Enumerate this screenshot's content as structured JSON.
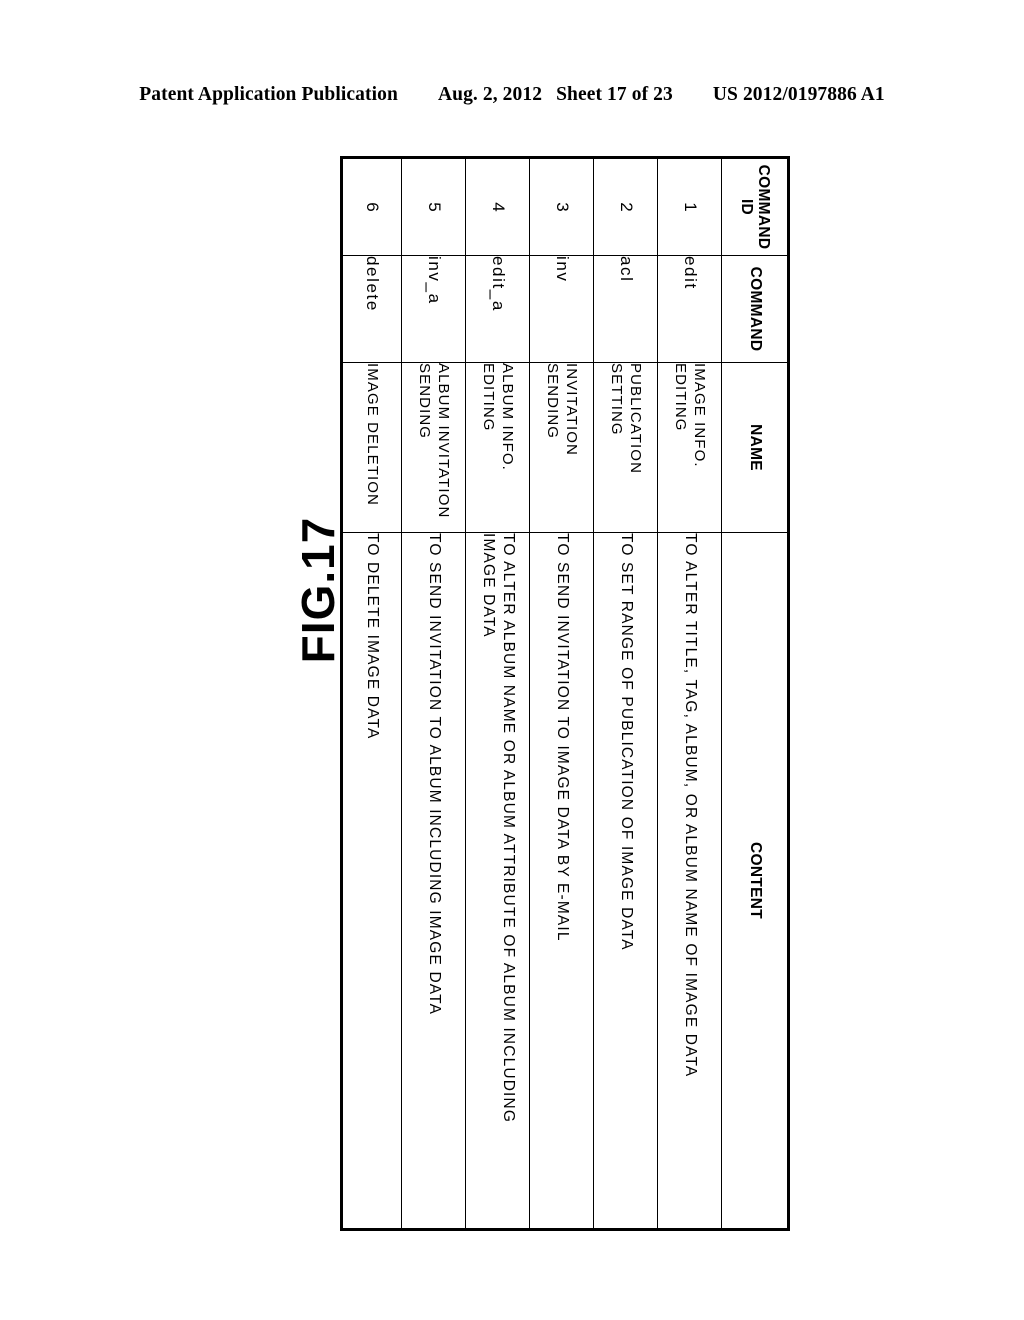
{
  "header": {
    "publication": "Patent Application Publication",
    "date": "Aug. 2, 2012",
    "sheet": "Sheet 17 of 23",
    "pub_number": "US 2012/0197886 A1"
  },
  "figure": {
    "label": "FIG.17"
  },
  "table": {
    "columns": [
      {
        "key": "command_id",
        "label": "COMMAND\nID"
      },
      {
        "key": "command",
        "label": "COMMAND"
      },
      {
        "key": "name",
        "label": "NAME"
      },
      {
        "key": "content",
        "label": "CONTENT"
      }
    ],
    "rows": [
      {
        "command_id": "1",
        "command": "edit",
        "name": "IMAGE INFO.\nEDITING",
        "content": "TO ALTER TITLE, TAG, ALBUM, OR ALBUM NAME OF IMAGE DATA"
      },
      {
        "command_id": "2",
        "command": "acl",
        "name": "PUBLICATION\nSETTING",
        "content": "TO SET RANGE OF PUBLICATION OF IMAGE DATA"
      },
      {
        "command_id": "3",
        "command": "inv",
        "name": "INVITATION\nSENDING",
        "content": "TO SEND INVITATION TO IMAGE DATA BY E-MAIL"
      },
      {
        "command_id": "4",
        "command": "edit_a",
        "name": "ALBUM INFO.\nEDITING",
        "content": "TO ALTER ALBUM NAME OR ALBUM ATTRIBUTE OF ALBUM INCLUDING\nIMAGE DATA"
      },
      {
        "command_id": "5",
        "command": "inv_a",
        "name": "ALBUM INVITATION\nSENDING",
        "content": "TO SEND INVITATION TO ALBUM INCLUDING IMAGE DATA"
      },
      {
        "command_id": "6",
        "command": "delete",
        "name": "IMAGE DELETION",
        "content": "TO DELETE IMAGE DATA"
      }
    ]
  }
}
